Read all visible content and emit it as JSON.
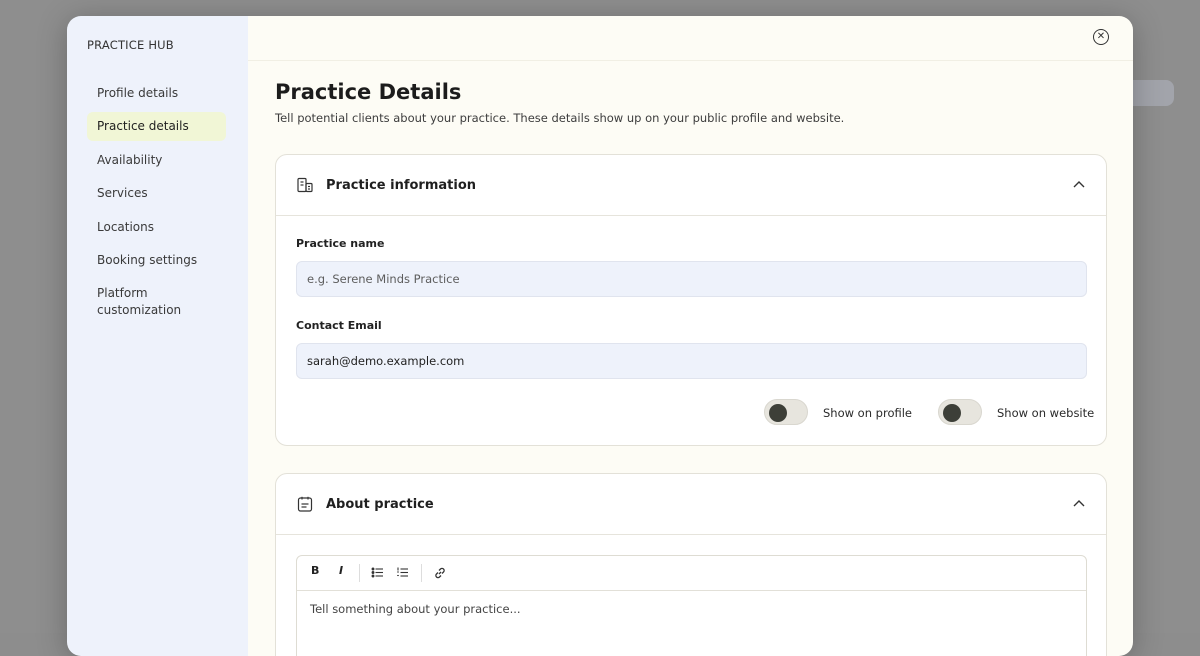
{
  "sidebar": {
    "title": "PRACTICE HUB",
    "items": [
      {
        "label": "Profile details"
      },
      {
        "label": "Practice details",
        "active": true
      },
      {
        "label": "Availability"
      },
      {
        "label": "Services"
      },
      {
        "label": "Locations"
      },
      {
        "label": "Booking settings"
      },
      {
        "label": "Platform customization"
      }
    ]
  },
  "header": {
    "title": "Practice Details",
    "subtitle": "Tell potential clients about your practice. These details show up on your public profile and website."
  },
  "practice_info": {
    "title": "Practice information",
    "icon": "building-icon",
    "name_label": "Practice name",
    "name_placeholder": "e.g. Serene Minds Practice",
    "email_label": "Contact Email",
    "email_value": "sarah@demo.example.com",
    "toggle_profile_label": "Show on profile",
    "toggle_website_label": "Show on website"
  },
  "about": {
    "title": "About practice",
    "icon": "notes-icon",
    "toolbar": {
      "bold": "B",
      "italic": "I"
    },
    "placeholder": "Tell something about your practice..."
  },
  "colors": {
    "sidebar_bg": "#eef2fb",
    "main_bg": "#fdfcf5",
    "active_item_bg": "#f1f6d6",
    "input_bg": "#eef2fb",
    "toggle_knob": "#3d3f38"
  }
}
